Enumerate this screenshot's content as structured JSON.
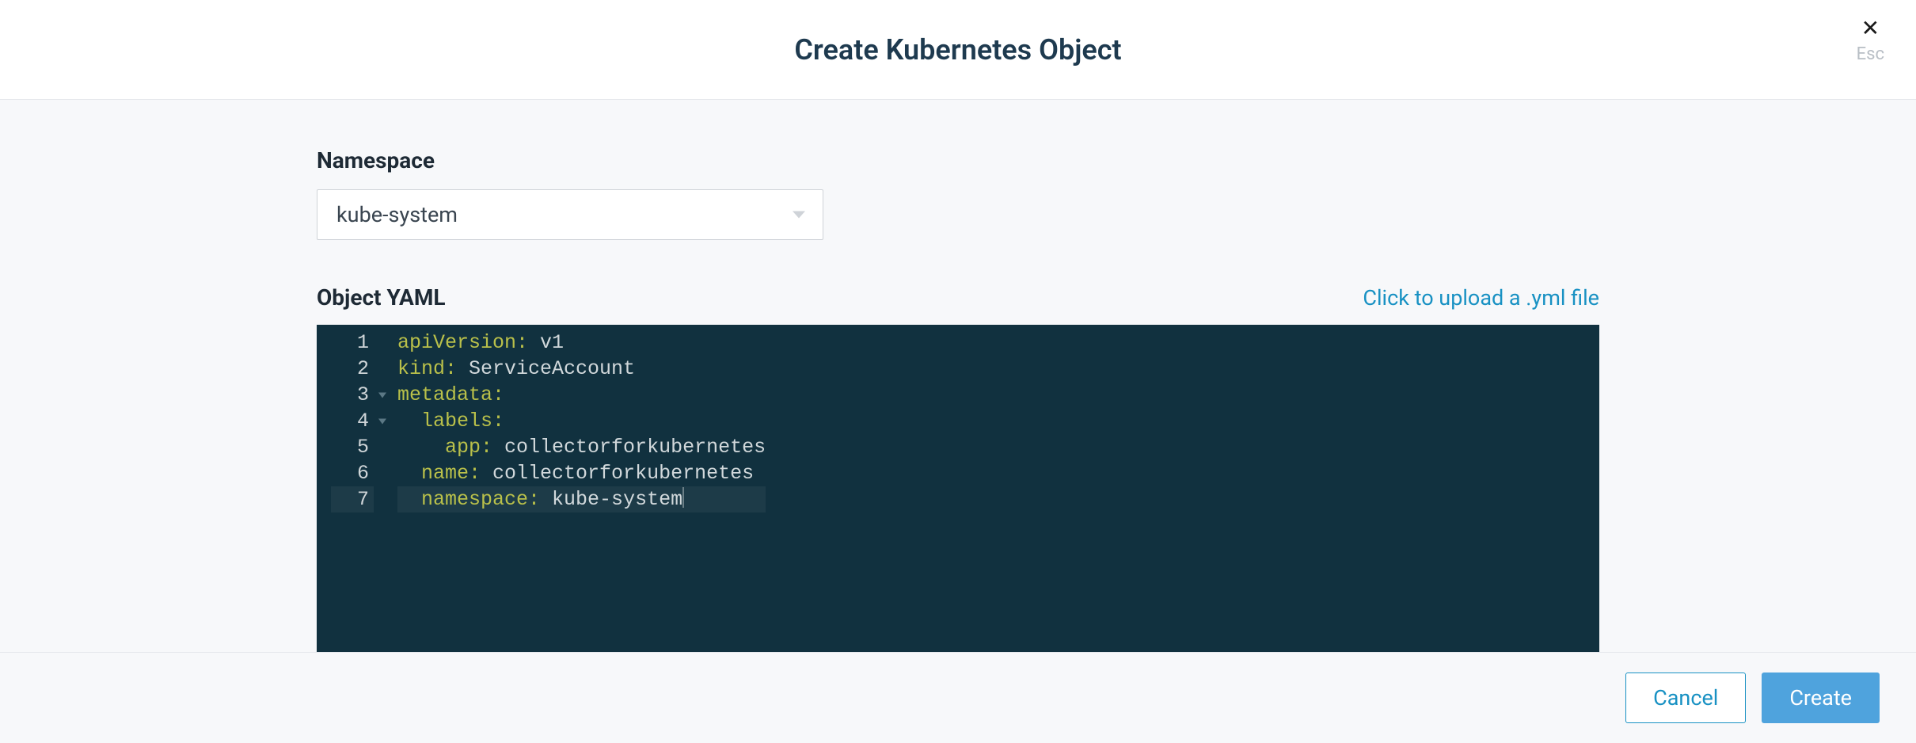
{
  "modal": {
    "title": "Create Kubernetes Object",
    "esc_label": "Esc"
  },
  "form": {
    "namespace_label": "Namespace",
    "namespace_value": "kube-system",
    "yaml_label": "Object YAML",
    "upload_link": "Click to upload a .yml file"
  },
  "editor": {
    "lines": [
      {
        "num": "1",
        "key": "apiVersion:",
        "val": " v1",
        "indent": "",
        "fold": false,
        "active": false
      },
      {
        "num": "2",
        "key": "kind:",
        "val": " ServiceAccount",
        "indent": "",
        "fold": false,
        "active": false
      },
      {
        "num": "3",
        "key": "metadata:",
        "val": "",
        "indent": "",
        "fold": true,
        "active": false
      },
      {
        "num": "4",
        "key": "labels:",
        "val": "",
        "indent": "  ",
        "fold": true,
        "active": false
      },
      {
        "num": "5",
        "key": "app:",
        "val": " collectorforkubernetes",
        "indent": "    ",
        "fold": false,
        "active": false
      },
      {
        "num": "6",
        "key": "name:",
        "val": " collectorforkubernetes",
        "indent": "  ",
        "fold": false,
        "active": false
      },
      {
        "num": "7",
        "key": "namespace:",
        "val": " kube-system",
        "indent": "  ",
        "fold": false,
        "active": true
      }
    ]
  },
  "footer": {
    "cancel": "Cancel",
    "create": "Create"
  }
}
